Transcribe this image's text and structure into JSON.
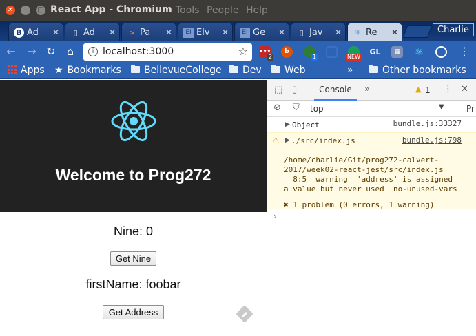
{
  "window": {
    "title": "React App - Chromium",
    "menu": [
      "Tools",
      "People",
      "Help"
    ]
  },
  "tabs": [
    {
      "label": "Ad",
      "icon": "b-icon",
      "active": false
    },
    {
      "label": "Ad",
      "icon": "document-icon",
      "active": false
    },
    {
      "label": "Pa",
      "icon": "chevron-icon",
      "active": false
    },
    {
      "label": "Elv",
      "icon": "elvenware-icon",
      "active": false
    },
    {
      "label": "Ge",
      "icon": "elvenware-icon",
      "active": false
    },
    {
      "label": "Jav",
      "icon": "document-icon",
      "active": false
    },
    {
      "label": "Re",
      "icon": "react-icon",
      "active": true
    }
  ],
  "profile": {
    "name": "Charlie"
  },
  "toolbar": {
    "address": "localhost:3000",
    "extensions": [
      {
        "icon": "trello-ext-icon",
        "color": "#c62828",
        "badge": "2"
      },
      {
        "icon": "bootstrap-ext-icon",
        "color": "#e65100",
        "badge": ""
      },
      {
        "icon": "green-ext-icon",
        "color": "#2e7d32",
        "badge": "1"
      },
      {
        "icon": "cast-icon",
        "color": "#3c6fc0",
        "badge": ""
      },
      {
        "icon": "new-ext-icon",
        "color": "#1b9e5a",
        "badge": "NEW"
      },
      {
        "icon": "gl-ext-icon",
        "color": "#2d63b5",
        "badge": "",
        "text": "GL"
      },
      {
        "icon": "grid-ext-icon",
        "color": "#7a8fb3",
        "badge": ""
      },
      {
        "icon": "react-devtools-icon",
        "color": "#2d63b5",
        "badge": ""
      },
      {
        "icon": "target-ext-icon",
        "color": "#2d63b5",
        "badge": ""
      }
    ]
  },
  "bookmarks": {
    "apps_label": "Apps",
    "bookmarks_label": "Bookmarks",
    "items": [
      "BellevueCollege",
      "Dev",
      "Web"
    ],
    "overflow": "»",
    "other_label": "Other bookmarks"
  },
  "app": {
    "title": "Welcome to Prog272",
    "nine_label": "Nine: 0",
    "get_nine_label": "Get Nine",
    "first_name_label": "firstName: foobar",
    "get_address_label": "Get Address",
    "header_color": "#222222",
    "logo_color": "#61dafb"
  },
  "devtools": {
    "active_tab": "Console",
    "more_tabs": "»",
    "warning_count": "1",
    "context": "top",
    "preserve_label": "Pr",
    "messages": {
      "object": {
        "text": "Object",
        "source": "bundle.js:33327"
      },
      "warning": {
        "file": "./src/index.js",
        "source": "bundle.js:798",
        "lines": [
          "/home/charlie/Git/prog272-calvert-",
          "2017/week02-react-jest/src/index.js",
          "  8:5  warning  'address' is assigned",
          "a value but never used  no-unused-vars",
          "",
          "✖ 1 problem (0 errors, 1 warning)"
        ]
      }
    },
    "prompt": "›"
  }
}
